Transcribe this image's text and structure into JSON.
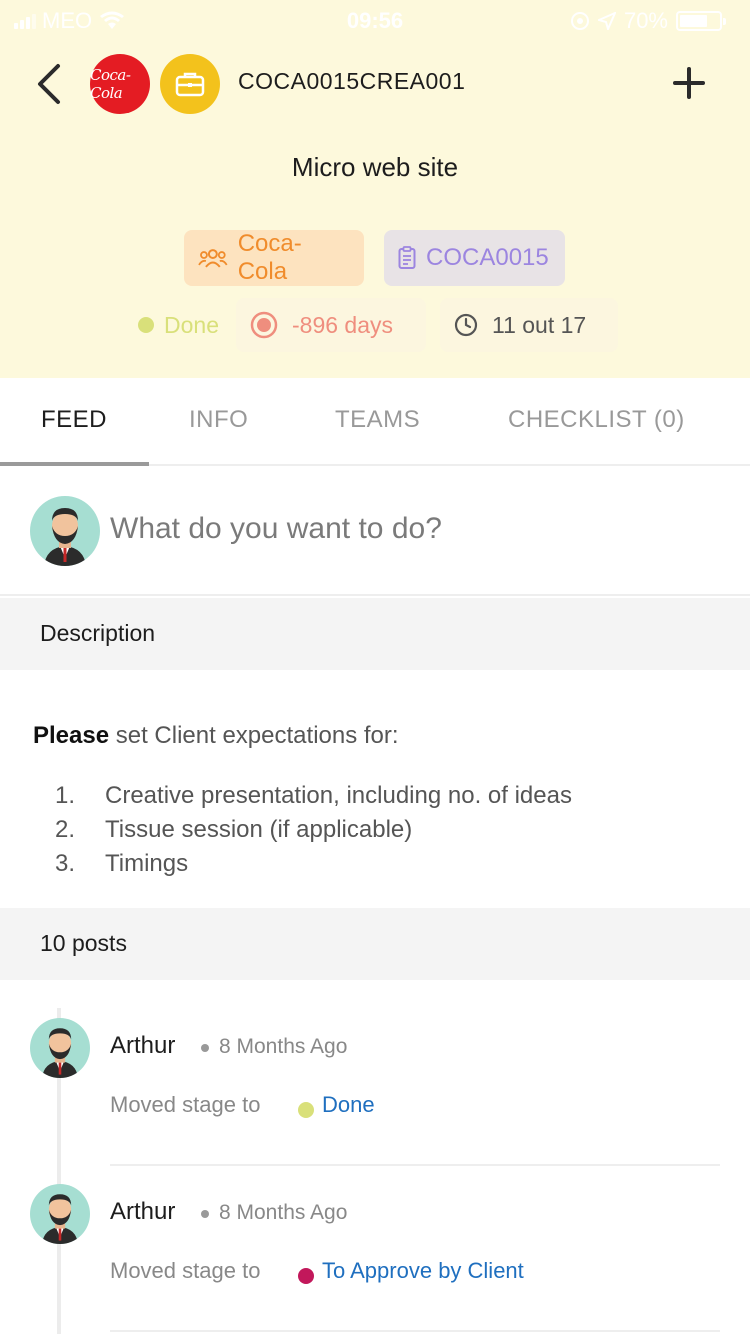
{
  "status_bar": {
    "carrier": "MEO",
    "time": "09:56",
    "battery": "70%",
    "battery_level": 0.7
  },
  "header": {
    "client_logo_text": "Coca-Cola",
    "job_code": "COCA0015CREA001",
    "job_title": "Micro web site",
    "client_chip": "Coca-Cola",
    "project_chip": "COCA0015",
    "status": "Done",
    "days": "-896 days",
    "checklist_count": "11 out 17",
    "colors": {
      "header_bg": "#fdf9dc",
      "client_chip_bg": "#fde3bf",
      "client_chip_text": "#f08c2c",
      "project_chip_bg": "#e8e3e6",
      "project_chip_text": "#9c85e0",
      "status_done": "#d9e07a",
      "days_overdue": "#ef8e7e"
    }
  },
  "tabs": [
    {
      "label": "FEED",
      "active": true
    },
    {
      "label": "INFO",
      "active": false
    },
    {
      "label": "TEAMS",
      "active": false
    },
    {
      "label": "CHECKLIST (0)",
      "active": false
    }
  ],
  "composer": {
    "placeholder": "What do you want to do?"
  },
  "description": {
    "section_label": "Description",
    "intro_bold": "Please",
    "intro_rest": "set Client expectations for:",
    "items": [
      {
        "num": "1.",
        "text": "Creative presentation, including no. of ideas"
      },
      {
        "num": "2.",
        "text": "Tissue session (if applicable)"
      },
      {
        "num": "3.",
        "text": "Timings"
      }
    ]
  },
  "posts": {
    "section_label": "10 posts",
    "items": [
      {
        "author": "Arthur",
        "time": "8 Months Ago",
        "action": "Moved stage to",
        "stage": "Done",
        "stage_color": "#d9e07a"
      },
      {
        "author": "Arthur",
        "time": "8 Months Ago",
        "action": "Moved stage to",
        "stage": "To Approve by Client",
        "stage_color": "#c2185b"
      }
    ]
  }
}
